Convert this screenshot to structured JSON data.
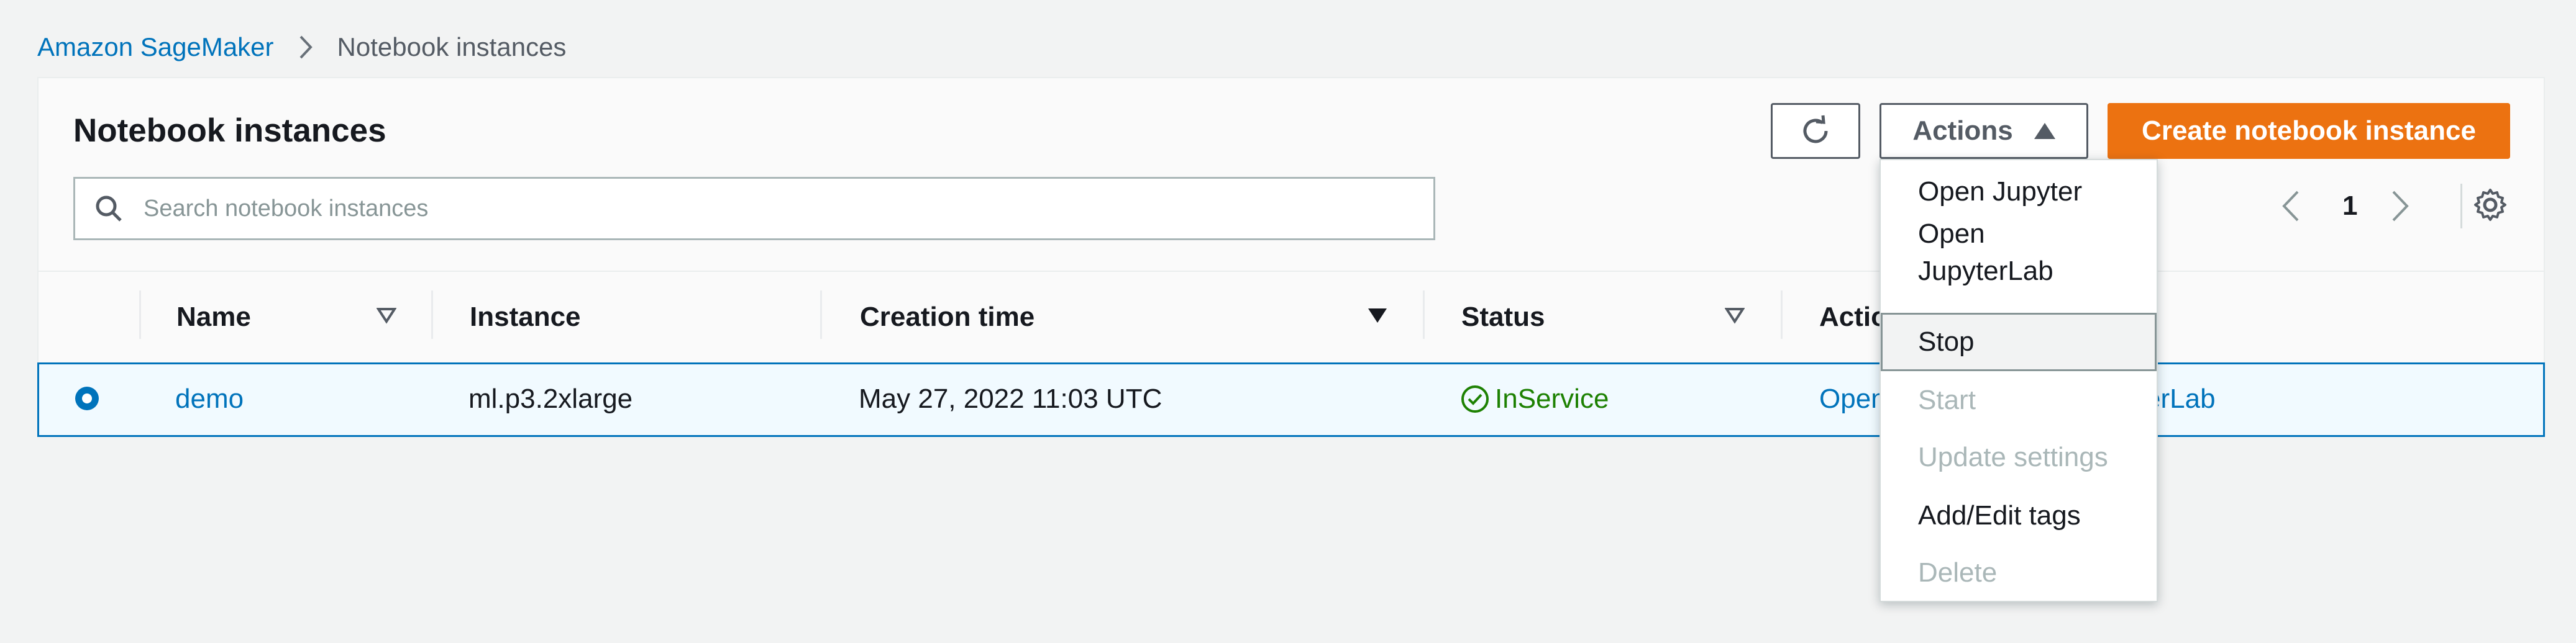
{
  "breadcrumb": {
    "root": "Amazon SageMaker",
    "current": "Notebook instances"
  },
  "panel": {
    "title": "Notebook instances"
  },
  "toolbar": {
    "refresh_icon": "refresh-icon",
    "actions_label": "Actions",
    "create_label": "Create notebook instance"
  },
  "search": {
    "placeholder": "Search notebook instances"
  },
  "pagination": {
    "current_page": "1"
  },
  "table": {
    "columns": [
      "Name",
      "Instance",
      "Creation time",
      "Status",
      "Actions"
    ],
    "rows": [
      {
        "name": "demo",
        "instance": "ml.p3.2xlarge",
        "creation_time": "May 27, 2022 11:03 UTC",
        "status": "InService",
        "actions_text": "Open Jupyter | Open JupyterLab"
      }
    ]
  },
  "actions_menu": {
    "items": [
      {
        "label": "Open Jupyter",
        "disabled": false
      },
      {
        "label": "Open\nJupyterLab",
        "disabled": false
      },
      {
        "label": "Stop",
        "disabled": false
      },
      {
        "label": "Start",
        "disabled": true
      },
      {
        "label": "Update settings",
        "disabled": true
      },
      {
        "label": "Add/Edit tags",
        "disabled": false
      },
      {
        "label": "Delete",
        "disabled": true
      }
    ]
  },
  "colors": {
    "link": "#0073bb",
    "primary_button": "#ec7211",
    "status_ok": "#1d8102",
    "disabled": "#aab7b8"
  }
}
